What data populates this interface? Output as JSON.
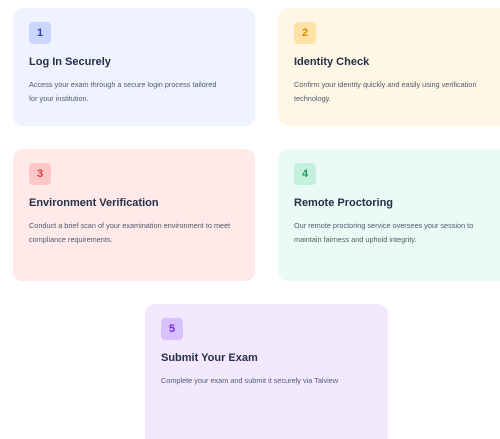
{
  "colors": {
    "card_1_bg": "#eef3ff",
    "card_1_badge_bg": "#c9d6ff",
    "card_1_badge_fg": "#2a3ea8",
    "card_2_bg": "#fff6e6",
    "card_2_badge_bg": "#ffe2a6",
    "card_2_badge_fg": "#cf8a00",
    "card_3_bg": "#ffe9e9",
    "card_3_badge_bg": "#ffc6c6",
    "card_3_badge_fg": "#d83a3a",
    "card_4_bg": "#eafaf4",
    "card_4_badge_bg": "#c5f0dd",
    "card_4_badge_fg": "#1a9b66",
    "card_5_bg": "#f3e9ff",
    "card_5_badge_bg": "#d8c0ff",
    "card_5_badge_fg": "#7a2ae0"
  },
  "steps": [
    {
      "number": "1",
      "title": "Log In Securely",
      "description": "Access your exam through a secure login process tailored for your institution."
    },
    {
      "number": "2",
      "title": "Identity Check",
      "description": "Confirm your identity quickly and easily using verification technology."
    },
    {
      "number": "3",
      "title": "Environment Verification",
      "description": "Conduct a brief scan of your examination environment to meet compliance requirements."
    },
    {
      "number": "4",
      "title": "Remote Proctoring",
      "description": "Our remote proctoring service oversees your session to maintain fairness and uphold integrity."
    },
    {
      "number": "5",
      "title": "Submit Your Exam",
      "description": "Complete your exam and submit it securely via Talview"
    }
  ]
}
